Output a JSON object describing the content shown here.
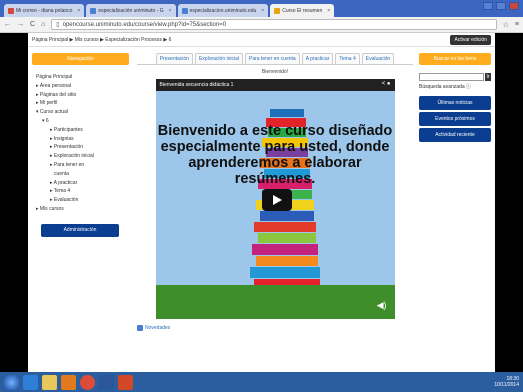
{
  "browser": {
    "tabs": [
      {
        "label": "Mi correo - diana polanco",
        "color": "#d64937"
      },
      {
        "label": "especialización uniminuto - G",
        "color": "#4a7fd4"
      },
      {
        "label": "especializacion.uniminuto.edu",
        "color": "#4a7fd4"
      },
      {
        "label": "Curso El resumen",
        "color": "#e8a317"
      }
    ],
    "url": "opencourse.uniminuto.edu/course/view.php?id=75&section=0"
  },
  "breadcrumb": "Página Principal ▶ Mis cursos ▶ Especialización Procesos ▶ 6",
  "edit_button": "Activar edición",
  "navigation": {
    "title": "Navegación",
    "items": [
      "Página Principal",
      "▸ Área personal",
      "▸ Páginas del sitio",
      "▸ Mi perfil",
      "▾ Curso actual",
      "  ▾ 6",
      "    ▸ Participantes",
      "    ▸ Insignias",
      "    ▸ Presentación",
      "    ▸ Exploración inicial",
      "    ▸ Para tener en",
      "       cuenta",
      "    ▸ A practicar",
      "    ▸ Tema 4",
      "    ▸ Evaluación",
      "▸ Mis cursos"
    ],
    "admin": "Administración"
  },
  "course_tabs": [
    "Presentación",
    "Exploración inicial",
    "Para tener en cuenta",
    "A practicar",
    "Tema 4",
    "Evaluación"
  ],
  "welcome": "Bienvenido!",
  "video": {
    "title": "Bienvenida secuencia didáctica 1",
    "overlay_text": "Bienvenido a este curso diseñado especialmente para usted, donde aprenderemos a elaborar resúmenes."
  },
  "novedades": "Novedades",
  "sidebar": {
    "search_title": "Buscar en los foros",
    "search_go": "Ir",
    "advanced": "Búsqueda avanzada",
    "buttons": [
      "Últimas noticias",
      "Eventos próximos",
      "Actividad reciente"
    ]
  },
  "taskbar": {
    "time": "18:30",
    "date": "10/11/2014"
  }
}
